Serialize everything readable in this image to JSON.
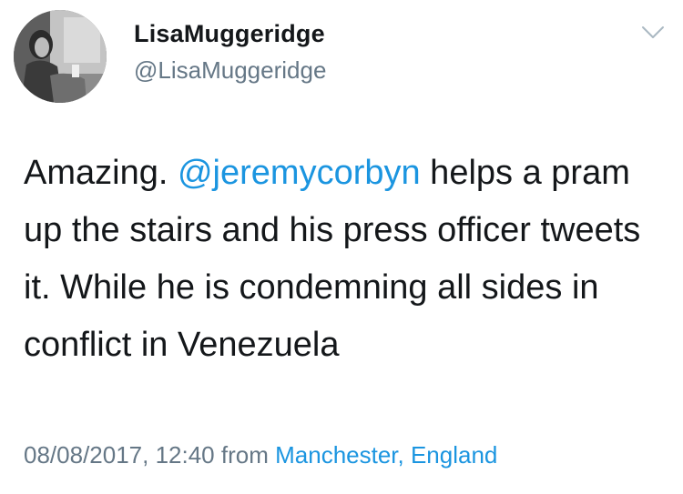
{
  "author": {
    "display_name": "LisaMuggeridge",
    "handle": "@LisaMuggeridge",
    "avatar_icon": "profile-photo"
  },
  "menu": {
    "icon": "chevron-down-icon"
  },
  "tweet": {
    "text_before_mention": "Amazing. ",
    "mention": "@jeremycorbyn",
    "text_after_mention": " helps a pram up the stairs and his press officer tweets it. While he is condemning all sides in conflict in Venezuela"
  },
  "meta": {
    "timestamp": "08/08/2017, 12:40",
    "from_label": "from",
    "location": "Manchester, England"
  },
  "colors": {
    "link": "#1b95e0",
    "secondary_text": "#657786",
    "primary_text": "#14171a"
  }
}
